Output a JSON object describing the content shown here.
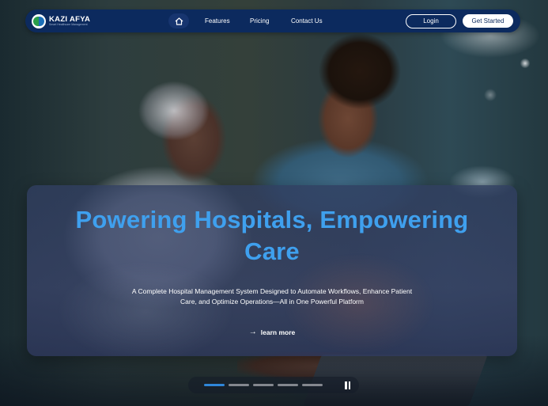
{
  "brand": {
    "name": "KAZI AFYA",
    "tagline": "Smart Healthcare Management"
  },
  "nav": {
    "items": [
      {
        "label": "Features"
      },
      {
        "label": "Pricing"
      },
      {
        "label": "Contact Us"
      }
    ],
    "login_label": "Login",
    "get_started_label": "Get Started"
  },
  "hero": {
    "title_line1": "Powering Hospitals, Empowering",
    "title_line2": "Care",
    "subtitle_line1": "A Complete Hospital Management System Designed to Automate Workflows, Enhance Patient",
    "subtitle_line2": "Care, and Optimize Operations—All in One Powerful Platform",
    "cta_label": "learn more",
    "title_color": "#3fa0ee"
  },
  "carousel": {
    "slide_count": 5,
    "active_slide": 1,
    "state": "playing"
  },
  "colors": {
    "navbar": "#0c2a5e",
    "accent": "#2f86d8"
  }
}
